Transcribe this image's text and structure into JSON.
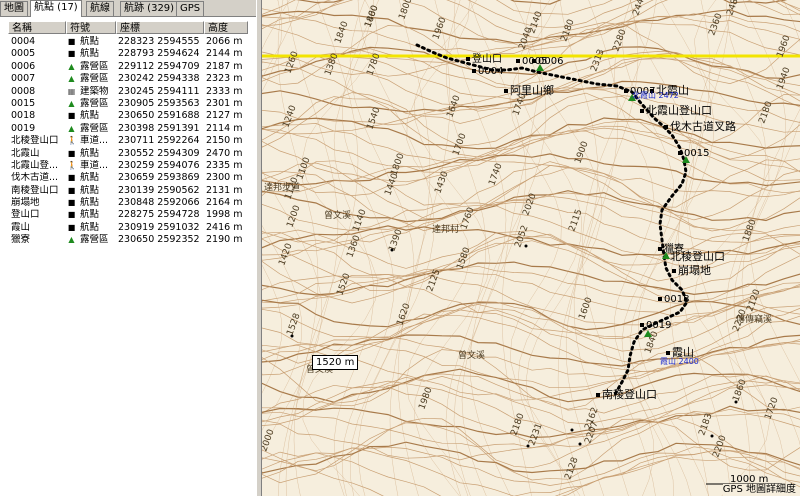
{
  "tabs": [
    {
      "label": "地圖"
    },
    {
      "label": "航點 (17)"
    },
    {
      "label": "航線"
    },
    {
      "label": "航跡 (329)"
    },
    {
      "label": "GPS"
    }
  ],
  "table": {
    "headers": [
      "名稱",
      "符號",
      "座標",
      "高度"
    ],
    "rows": [
      {
        "name": "0004",
        "sym": "航點",
        "coord": "228323 2594555",
        "alt": "2066 m",
        "icon": "square"
      },
      {
        "name": "0005",
        "sym": "航點",
        "coord": "228793 2594624",
        "alt": "2144 m",
        "icon": "square"
      },
      {
        "name": "0006",
        "sym": "露營區",
        "coord": "229112 2594709",
        "alt": "2187 m",
        "icon": "tent"
      },
      {
        "name": "0007",
        "sym": "露營區",
        "coord": "230242 2594338",
        "alt": "2323 m",
        "icon": "tent"
      },
      {
        "name": "0008",
        "sym": "建築物",
        "coord": "230245 2594111",
        "alt": "2333 m",
        "icon": "building"
      },
      {
        "name": "0015",
        "sym": "露營區",
        "coord": "230905 2593563",
        "alt": "2301 m",
        "icon": "tent"
      },
      {
        "name": "0018",
        "sym": "航點",
        "coord": "230650 2591688",
        "alt": "2127 m",
        "icon": "square"
      },
      {
        "name": "0019",
        "sym": "露營區",
        "coord": "230398 2591391",
        "alt": "2114 m",
        "icon": "tent"
      },
      {
        "name": "北稜登山口",
        "sym": "車道...",
        "coord": "230711 2592264",
        "alt": "2150 m",
        "icon": "hiker"
      },
      {
        "name": "北霞山",
        "sym": "航點",
        "coord": "230552 2594309",
        "alt": "2470 m",
        "icon": "square"
      },
      {
        "name": "北霞山登...",
        "sym": "車道...",
        "coord": "230259 2594076",
        "alt": "2335 m",
        "icon": "hiker"
      },
      {
        "name": "伐木古道...",
        "sym": "航點",
        "coord": "230659 2593869",
        "alt": "2300 m",
        "icon": "square"
      },
      {
        "name": "南稜登山口",
        "sym": "航點",
        "coord": "230139 2590562",
        "alt": "2131 m",
        "icon": "square"
      },
      {
        "name": "崩塌地",
        "sym": "航點",
        "coord": "230848 2592066",
        "alt": "2164 m",
        "icon": "square"
      },
      {
        "name": "登山口",
        "sym": "航點",
        "coord": "228275 2594728",
        "alt": "1998 m",
        "icon": "square"
      },
      {
        "name": "霞山",
        "sym": "航點",
        "coord": "230919 2591032",
        "alt": "2416 m",
        "icon": "square"
      },
      {
        "name": "獵寮",
        "sym": "露營區",
        "coord": "230650 2592352",
        "alt": "2190 m",
        "icon": "tent"
      }
    ]
  },
  "map": {
    "contour_labels": [
      "1860",
      "1960",
      "2040",
      "2140",
      "2180",
      "2280",
      "2360",
      "2440",
      "2480",
      "1780",
      "1800",
      "2313",
      "1840",
      "1640",
      "1740",
      "1900",
      "1700",
      "1800",
      "1540",
      "1440",
      "1430",
      "1240",
      "1260",
      "1380",
      "1120",
      "1100",
      "1140",
      "1200",
      "1390",
      "1760",
      "1580",
      "2052",
      "2115",
      "2020",
      "1740",
      "1620",
      "1360",
      "1520",
      "1420",
      "1528",
      "1880",
      "2220",
      "1960",
      "2180",
      "1980",
      "2000",
      "2180",
      "2231",
      "2162",
      "2207",
      "2128",
      "2183",
      "1860",
      "1940",
      "2120",
      "2200",
      "2125",
      "1600",
      "1840",
      "1720",
      "1400"
    ],
    "waypoint_labels": [
      {
        "text": "登山口"
      },
      {
        "text": "0004"
      },
      {
        "text": "0005"
      },
      {
        "text": "0006"
      },
      {
        "text": "阿里山鄉"
      },
      {
        "text": "0007"
      },
      {
        "text": "北霞山"
      },
      {
        "text": "北霞山登山口"
      },
      {
        "text": "伐木古道叉路"
      },
      {
        "text": "0015"
      },
      {
        "text": "獵寮"
      },
      {
        "text": "北稜登山口"
      },
      {
        "text": "崩塌地"
      },
      {
        "text": "0018"
      },
      {
        "text": "0019"
      },
      {
        "text": "霞山"
      },
      {
        "text": "南稜登山口"
      }
    ],
    "place_labels": [
      "曾文溪",
      "達邦村",
      "曾文溪",
      "曾文溪",
      "傳傳竊溪",
      "達邦步道"
    ],
    "blue_labels": [
      "北霞山 2472",
      "霞山 2400"
    ],
    "scale_box": "1520 m",
    "scale_bar": "1000 m",
    "status_text": "GPS 地圖詳細度"
  },
  "colors": {
    "map_bg": "#f6eedd",
    "contour": "#c9a074",
    "contour_index": "#a87a4a",
    "track": "#000000",
    "boundary": "#f2e400",
    "camp_green": "#1e8a1e",
    "blue_label": "#1a2ad0"
  }
}
